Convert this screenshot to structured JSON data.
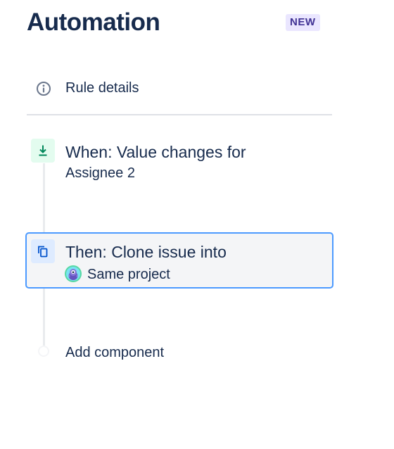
{
  "header": {
    "title": "Automation",
    "badge": "NEW"
  },
  "rule_details": {
    "label": "Rule details",
    "icon": "info-icon"
  },
  "steps": [
    {
      "type": "trigger",
      "icon": "branch-arrow-down-icon",
      "title": "When: Value changes for",
      "subtitle": "Assignee 2",
      "accent": "#00875a",
      "icon_bg": "#e3fcef"
    },
    {
      "type": "action",
      "icon": "clone-icon",
      "title": "Then: Clone issue into",
      "subtitle": "Same project",
      "avatar": "project-avatar",
      "selected": true,
      "accent": "#0052cc",
      "icon_bg": "#deebff",
      "selected_border": "#4c9aff"
    }
  ],
  "add_component": {
    "label": "Add component"
  }
}
